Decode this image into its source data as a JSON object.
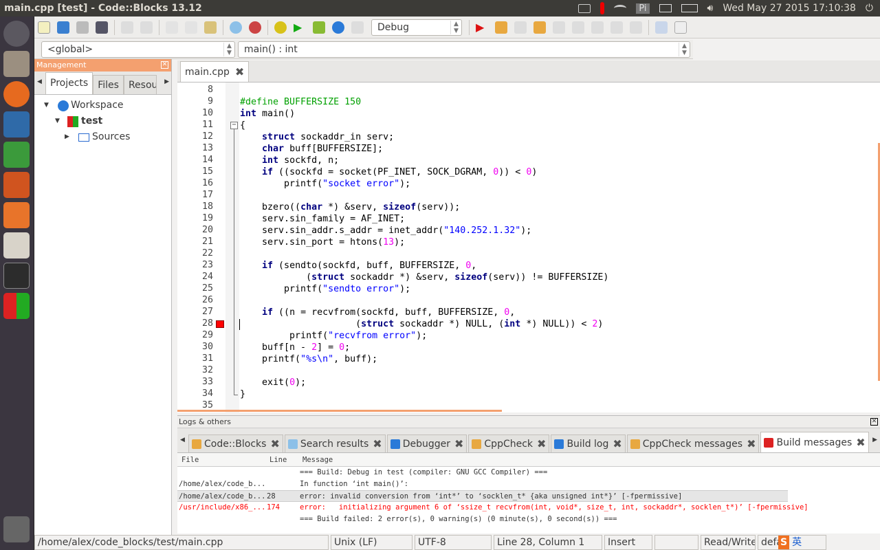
{
  "window": {
    "title": "main.cpp [test] - Code::Blocks 13.12"
  },
  "tray": {
    "indicator_text": "Pi",
    "clock": "Wed May 27 2015 17:10:38",
    "icons": [
      "keyboard-icon",
      "thermometer-icon",
      "wifi-icon",
      "pi-icon",
      "mail-icon",
      "battery-icon",
      "volume-icon",
      "power-icon"
    ]
  },
  "launcher": {
    "apps": [
      "ubuntu-dash",
      "files",
      "firefox",
      "writer",
      "calc",
      "impress",
      "software-center",
      "amazon",
      "terminal",
      "codeblocks",
      "trash"
    ]
  },
  "toolbar": {
    "build_target": "Debug",
    "scope": "<global>",
    "function": "main() : int"
  },
  "management": {
    "title": "Management",
    "tabs": [
      "Projects",
      "Files",
      "Resou"
    ],
    "tree": {
      "workspace": "Workspace",
      "project": "test",
      "folder": "Sources"
    }
  },
  "editor": {
    "tab": "main.cpp",
    "breakpoint_line": 28,
    "lines": [
      {
        "n": "8",
        "t": []
      },
      {
        "n": "9",
        "t": [
          [
            "p",
            "#define BUFFERSIZE 150"
          ]
        ]
      },
      {
        "n": "10",
        "t": [
          [
            "k",
            "int"
          ],
          [
            "n",
            " main()"
          ]
        ]
      },
      {
        "n": "11",
        "t": [
          [
            "n",
            "{"
          ]
        ]
      },
      {
        "n": "12",
        "t": [
          [
            "n",
            "    "
          ],
          [
            "k",
            "struct"
          ],
          [
            "n",
            " sockaddr_in serv;"
          ]
        ]
      },
      {
        "n": "13",
        "t": [
          [
            "n",
            "    "
          ],
          [
            "k",
            "char"
          ],
          [
            "n",
            " buff[BUFFERSIZE];"
          ]
        ]
      },
      {
        "n": "14",
        "t": [
          [
            "n",
            "    "
          ],
          [
            "k",
            "int"
          ],
          [
            "n",
            " sockfd, n;"
          ]
        ]
      },
      {
        "n": "15",
        "t": [
          [
            "n",
            "    "
          ],
          [
            "k",
            "if"
          ],
          [
            "n",
            " ((sockfd = socket(PF_INET, SOCK_DGRAM, "
          ],
          [
            "m",
            "0"
          ],
          [
            "n",
            ")) < "
          ],
          [
            "m",
            "0"
          ],
          [
            "n",
            ")"
          ]
        ]
      },
      {
        "n": "16",
        "t": [
          [
            "n",
            "        printf("
          ],
          [
            "s",
            "\"socket error\""
          ],
          [
            "n",
            ");"
          ]
        ]
      },
      {
        "n": "17",
        "t": []
      },
      {
        "n": "18",
        "t": [
          [
            "n",
            "    bzero(("
          ],
          [
            "k",
            "char"
          ],
          [
            "n",
            " *) &serv, "
          ],
          [
            "k",
            "sizeof"
          ],
          [
            "n",
            "(serv));"
          ]
        ]
      },
      {
        "n": "19",
        "t": [
          [
            "n",
            "    serv.sin_family = AF_INET;"
          ]
        ]
      },
      {
        "n": "20",
        "t": [
          [
            "n",
            "    serv.sin_addr.s_addr = inet_addr("
          ],
          [
            "s",
            "\"140.252.1.32\""
          ],
          [
            "n",
            ");"
          ]
        ]
      },
      {
        "n": "21",
        "t": [
          [
            "n",
            "    serv.sin_port = htons("
          ],
          [
            "m",
            "13"
          ],
          [
            "n",
            ");"
          ]
        ]
      },
      {
        "n": "22",
        "t": []
      },
      {
        "n": "23",
        "t": [
          [
            "n",
            "    "
          ],
          [
            "k",
            "if"
          ],
          [
            "n",
            " (sendto(sockfd, buff, BUFFERSIZE, "
          ],
          [
            "m",
            "0"
          ],
          [
            "n",
            ","
          ]
        ]
      },
      {
        "n": "24",
        "t": [
          [
            "n",
            "            ("
          ],
          [
            "k",
            "struct"
          ],
          [
            "n",
            " sockaddr *) &serv, "
          ],
          [
            "k",
            "sizeof"
          ],
          [
            "n",
            "(serv)) != BUFFERSIZE)"
          ]
        ]
      },
      {
        "n": "25",
        "t": [
          [
            "n",
            "        printf("
          ],
          [
            "s",
            "\"sendto error\""
          ],
          [
            "n",
            ");"
          ]
        ]
      },
      {
        "n": "26",
        "t": []
      },
      {
        "n": "27",
        "t": [
          [
            "n",
            "    "
          ],
          [
            "k",
            "if"
          ],
          [
            "n",
            " ((n = recvfrom(sockfd, buff, BUFFERSIZE, "
          ],
          [
            "m",
            "0"
          ],
          [
            "n",
            ","
          ]
        ]
      },
      {
        "n": "28",
        "t": [
          [
            "n",
            "                     ("
          ],
          [
            "k",
            "struct"
          ],
          [
            "n",
            " sockaddr *) NULL, ("
          ],
          [
            "k",
            "int"
          ],
          [
            "n",
            " *) NULL)) < "
          ],
          [
            "m",
            "2"
          ],
          [
            "n",
            ")"
          ]
        ]
      },
      {
        "n": "29",
        "t": [
          [
            "n",
            "         printf("
          ],
          [
            "s",
            "\"recvfrom error\""
          ],
          [
            "n",
            ");"
          ]
        ]
      },
      {
        "n": "30",
        "t": [
          [
            "n",
            "    buff[n - "
          ],
          [
            "m",
            "2"
          ],
          [
            "n",
            "] = "
          ],
          [
            "m",
            "0"
          ],
          [
            "n",
            ";"
          ]
        ]
      },
      {
        "n": "31",
        "t": [
          [
            "n",
            "    printf("
          ],
          [
            "s",
            "\"%s\\n\""
          ],
          [
            "n",
            ", buff);"
          ]
        ]
      },
      {
        "n": "32",
        "t": []
      },
      {
        "n": "33",
        "t": [
          [
            "n",
            "    exit("
          ],
          [
            "m",
            "0"
          ],
          [
            "n",
            ");"
          ]
        ]
      },
      {
        "n": "34",
        "t": [
          [
            "n",
            "}"
          ]
        ]
      },
      {
        "n": "35",
        "t": []
      }
    ]
  },
  "logs": {
    "title": "Logs & others",
    "tabs": [
      {
        "label": "Code::Blocks",
        "icon": "note-icon"
      },
      {
        "label": "Search results",
        "icon": "search-icon"
      },
      {
        "label": "Debugger",
        "icon": "debug-icon"
      },
      {
        "label": "CppCheck",
        "icon": "note-icon"
      },
      {
        "label": "Build log",
        "icon": "refresh-icon"
      },
      {
        "label": "CppCheck messages",
        "icon": "note-icon"
      },
      {
        "label": "Build messages",
        "icon": "pin-icon"
      }
    ],
    "columns": [
      "File",
      "Line",
      "Message"
    ],
    "rows": [
      {
        "file": "",
        "line": "",
        "msg": "=== Build: Debug in test (compiler: GNU GCC Compiler) ===",
        "kind": "info"
      },
      {
        "file": "/home/alex/code_b...",
        "line": "",
        "msg": "In function ‘int main()’:",
        "kind": "info"
      },
      {
        "file": "/home/alex/code_b...",
        "line": "28",
        "msg": "error: invalid conversion from ‘int*’ to ‘socklen_t* {aka unsigned int*}’ [-fpermissive]",
        "kind": "selected"
      },
      {
        "file": "/usr/include/x86_...",
        "line": "174",
        "msg": "error:   initializing argument 6 of ‘ssize_t recvfrom(int, void*, size_t, int, sockaddr*, socklen_t*)’ [-fpermissive]",
        "kind": "error"
      },
      {
        "file": "",
        "line": "",
        "msg": "=== Build failed: 2 error(s), 0 warning(s) (0 minute(s), 0 second(s)) ===",
        "kind": "info"
      }
    ]
  },
  "status": {
    "path": "/home/alex/code_blocks/test/main.cpp",
    "eol": "Unix (LF)",
    "encoding": "UTF-8",
    "position": "Line 28, Column 1",
    "mode": "Insert",
    "access": "Read/Write",
    "extra": "defa",
    "ime": "英"
  },
  "colors": {
    "accent": "#f4a06f",
    "keyword": "#00007f",
    "string": "#0000ff",
    "number": "#f000f0",
    "preprocessor": "#00a000",
    "error": "#ff0000",
    "breakpoint": "#ff0000"
  }
}
